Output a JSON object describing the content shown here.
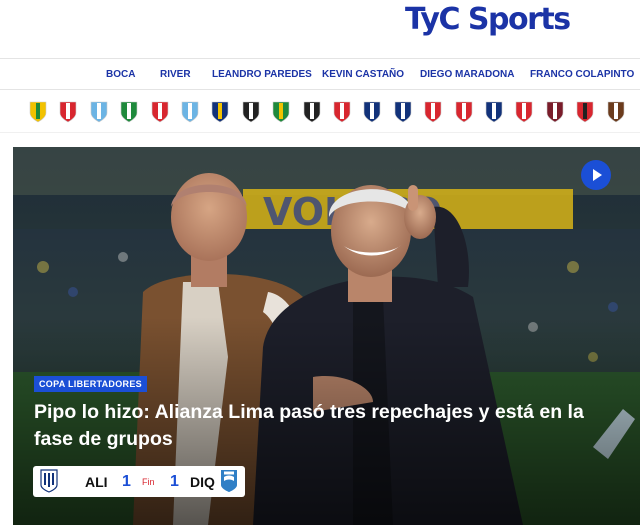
{
  "brand": {
    "logo_text": "TyC Sports",
    "accent": "#1b4fd6",
    "brand_blue": "#1b33a6"
  },
  "nav_tags": [
    {
      "label": "BOCA"
    },
    {
      "label": "RIVER"
    },
    {
      "label": "LEANDRO PAREDES"
    },
    {
      "label": "KEVIN CASTAÑO"
    },
    {
      "label": "DIEGO MARADONA"
    },
    {
      "label": "FRANCO COLAPINTO"
    }
  ],
  "club_crests": [
    {
      "icon": "aldosivi-crest-icon",
      "colors": [
        "#f2c200",
        "#1f8a3c"
      ]
    },
    {
      "icon": "argentinos-crest-icon",
      "colors": [
        "#d8262f",
        "#ffffff"
      ]
    },
    {
      "icon": "atletico-tucuman-crest-icon",
      "colors": [
        "#6cb4e4",
        "#ffffff"
      ]
    },
    {
      "icon": "banfield-crest-icon",
      "colors": [
        "#1f8a3c",
        "#ffffff"
      ]
    },
    {
      "icon": "barracas-crest-icon",
      "colors": [
        "#d8262f",
        "#ffffff"
      ]
    },
    {
      "icon": "belgrano-crest-icon",
      "colors": [
        "#6cb4e4",
        "#ffffff"
      ]
    },
    {
      "icon": "boca-crest-icon",
      "colors": [
        "#12327a",
        "#f2c200"
      ]
    },
    {
      "icon": "central-cordoba-crest-icon",
      "colors": [
        "#222222",
        "#ffffff"
      ]
    },
    {
      "icon": "defensa-crest-icon",
      "colors": [
        "#1f8a3c",
        "#f2c200"
      ]
    },
    {
      "icon": "deportivo-riestra-crest-icon",
      "colors": [
        "#222222",
        "#ffffff"
      ]
    },
    {
      "icon": "estudiantes-crest-icon",
      "colors": [
        "#d8262f",
        "#ffffff"
      ]
    },
    {
      "icon": "gimnasia-crest-icon",
      "colors": [
        "#12327a",
        "#ffffff"
      ]
    },
    {
      "icon": "godoy-cruz-crest-icon",
      "colors": [
        "#12327a",
        "#ffffff"
      ]
    },
    {
      "icon": "huracan-crest-icon",
      "colors": [
        "#d8262f",
        "#ffffff"
      ]
    },
    {
      "icon": "independiente-crest-icon",
      "colors": [
        "#d8262f",
        "#ffffff"
      ]
    },
    {
      "icon": "independiente-rivadavia-crest-icon",
      "colors": [
        "#12327a",
        "#ffffff"
      ]
    },
    {
      "icon": "instituto-crest-icon",
      "colors": [
        "#d8262f",
        "#ffffff"
      ]
    },
    {
      "icon": "lanus-crest-icon",
      "colors": [
        "#7a1c2a",
        "#ffffff"
      ]
    },
    {
      "icon": "newells-crest-icon",
      "colors": [
        "#d8262f",
        "#222222"
      ]
    },
    {
      "icon": "platense-crest-icon",
      "colors": [
        "#6b3b1c",
        "#ffffff"
      ]
    }
  ],
  "hero": {
    "category": "COPA LIBERTADORES",
    "headline": "Pipo lo hizo: Alianza Lima pasó tres repechajes y está en la fase de grupos",
    "play_icon": "play-icon"
  },
  "scoreboard": {
    "home_team": "ALI",
    "home_score": "1",
    "status": "Fin",
    "away_score": "1",
    "away_team": "DIQ",
    "home_crest_icon": "alianza-lima-crest-icon",
    "away_crest_icon": "deportivo-iquique-crest-icon"
  }
}
